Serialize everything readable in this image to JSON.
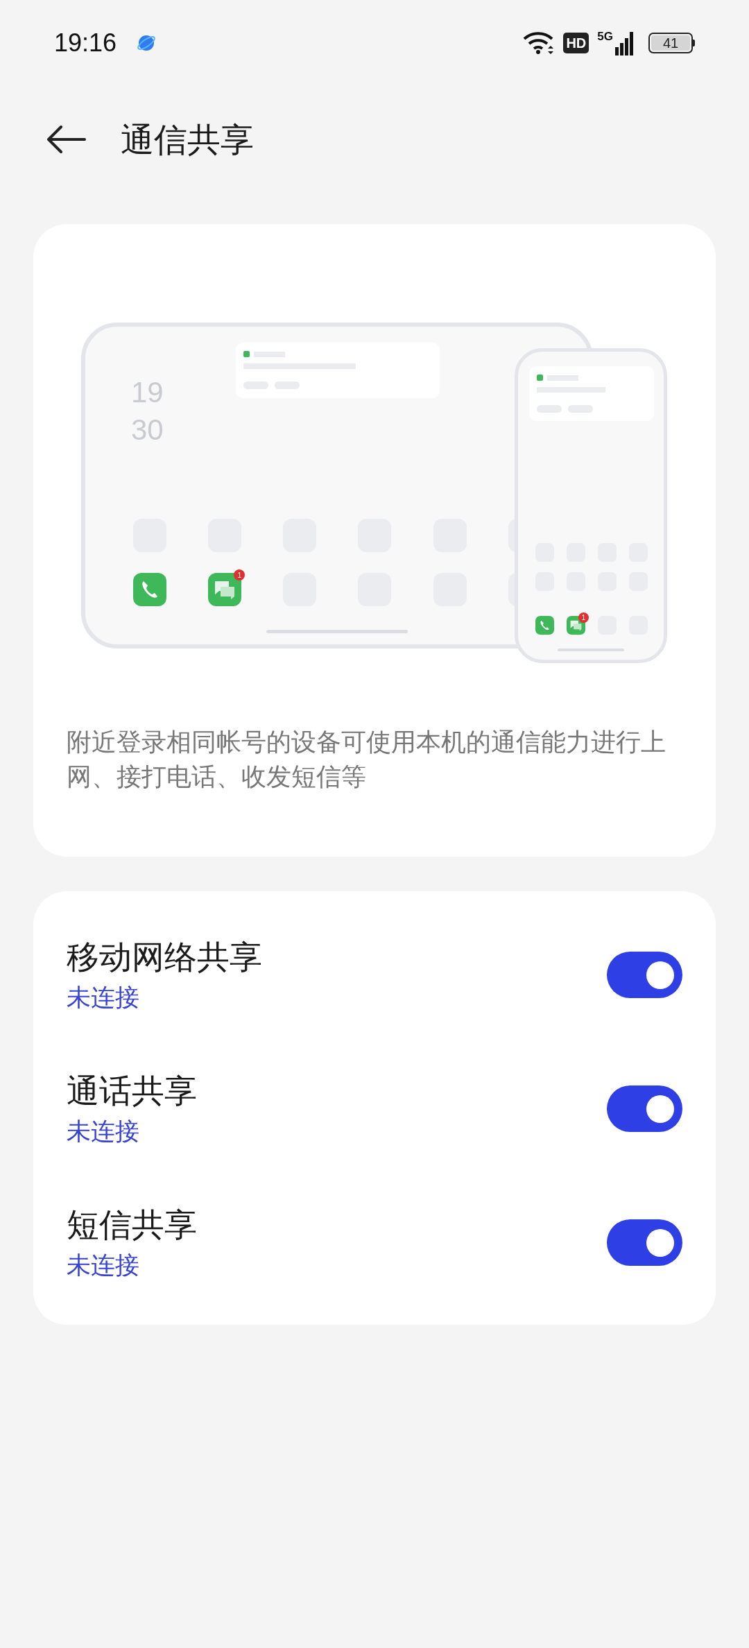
{
  "status_bar": {
    "time": "19:16",
    "hd": "HD",
    "network": "5G",
    "battery": "41"
  },
  "header": {
    "title": "通信共享"
  },
  "illustration": {
    "tablet": {
      "clock": [
        "19",
        "30"
      ],
      "message_badge": "1"
    },
    "phone": {
      "message_badge": "1"
    }
  },
  "description": "附近登录相同帐号的设备可使用本机的通信能力进行上网、接打电话、收发短信等",
  "toggles": [
    {
      "title": "移动网络共享",
      "status": "未连接",
      "on": true
    },
    {
      "title": "通话共享",
      "status": "未连接",
      "on": true
    },
    {
      "title": "短信共享",
      "status": "未连接",
      "on": true
    }
  ]
}
